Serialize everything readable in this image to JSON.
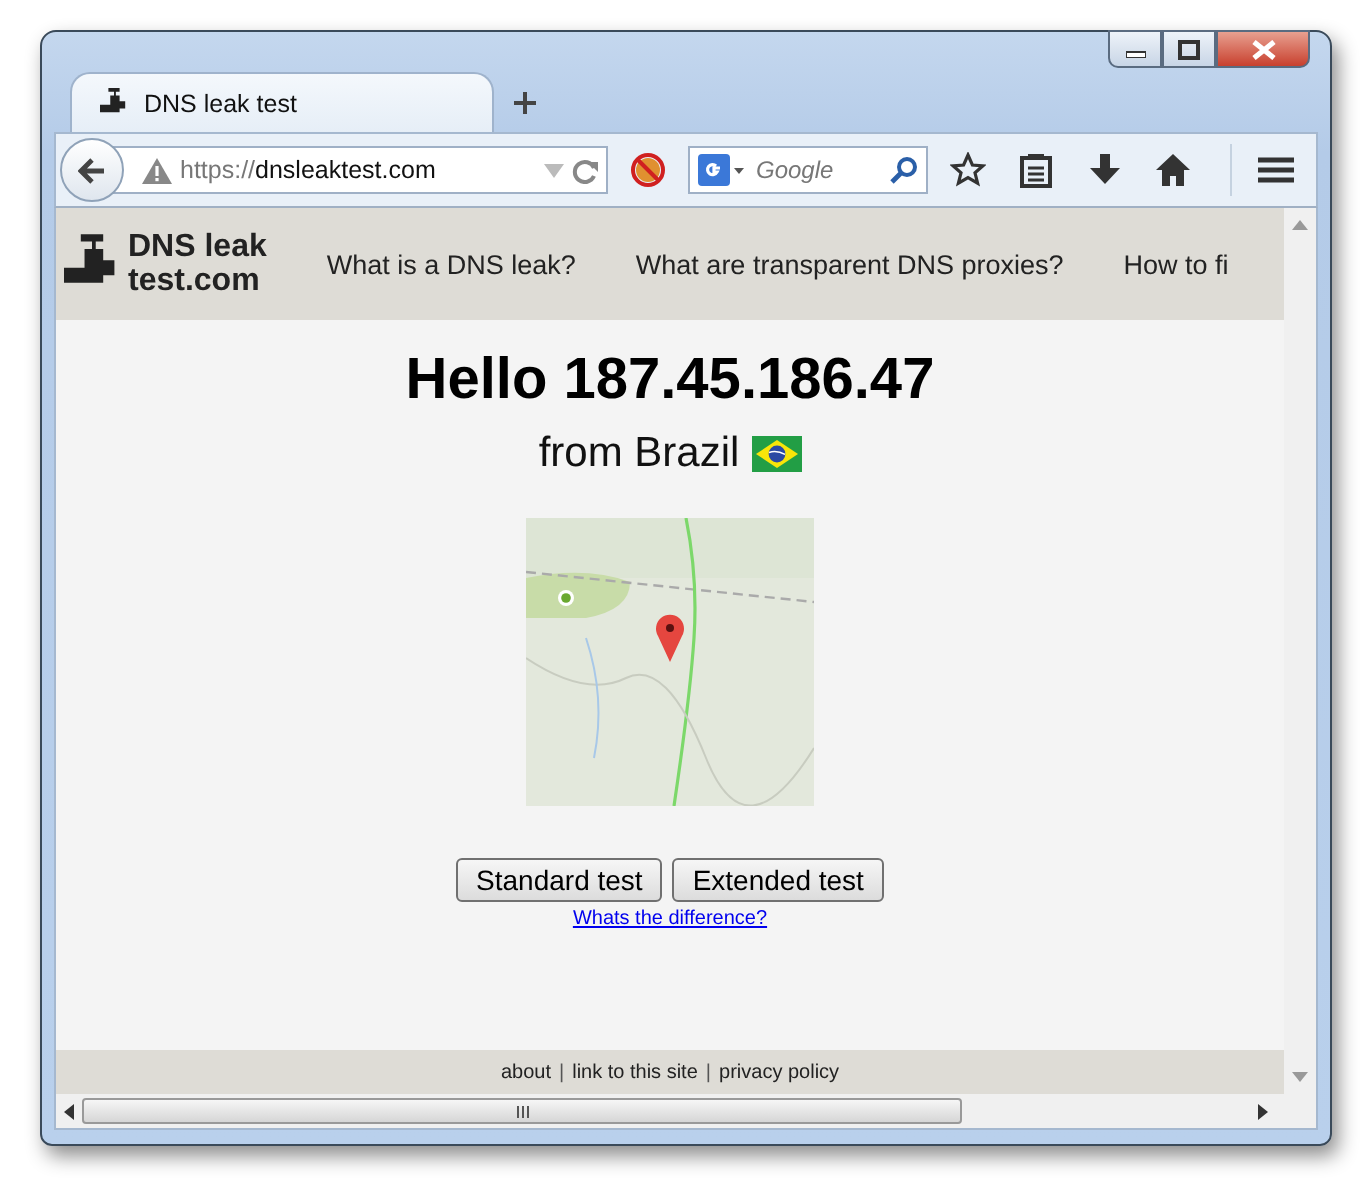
{
  "tab": {
    "title": "DNS leak test",
    "selected": true
  },
  "toolbar": {
    "url_scheme": "https://",
    "url_host": "dnsleaktest.com",
    "search": {
      "placeholder": "Google"
    }
  },
  "site": {
    "logo": [
      "DNS leak",
      "test.com"
    ],
    "nav": [
      "What is a DNS leak?",
      "What are transparent DNS proxies?",
      "How to fi"
    ],
    "heading": "Hello 187.45.186.47",
    "location": "from Brazil",
    "map": {
      "kind": "picture"
    },
    "buttons": [
      "Standard test",
      "Extended test"
    ],
    "difference_link": "Whats the difference?",
    "footer": [
      {
        "kind": "link",
        "text": "about"
      },
      {
        "kind": "sep",
        "text": "|"
      },
      {
        "kind": "link",
        "text": "link to this site"
      },
      {
        "kind": "sep",
        "text": "|"
      },
      {
        "kind": "link",
        "text": "privacy policy"
      }
    ]
  }
}
